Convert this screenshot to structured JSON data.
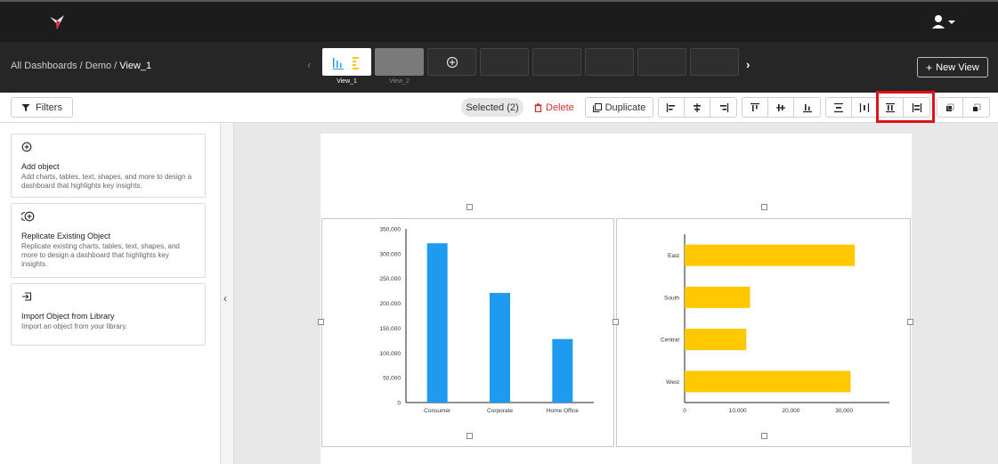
{
  "breadcrumb": {
    "root": "All Dashboards",
    "sep1": " / ",
    "mid": "Demo",
    "sep2": " / ",
    "current": "View_1"
  },
  "views": [
    {
      "label": "View_1"
    },
    {
      "label": "View_2"
    }
  ],
  "new_view_label": "New View",
  "toolbar": {
    "filters_label": "Filters",
    "selected_label": "Selected (2)",
    "delete_label": "Delete",
    "duplicate_label": "Duplicate"
  },
  "panel": {
    "items": [
      {
        "title": "Add object",
        "desc": "Add charts, tables, text, shapes, and more to design a dashboard that highlights key insights."
      },
      {
        "title": "Replicate Existing Object",
        "desc": "Replicate existing charts, tables, text, shapes, and more to design a dashboard that highlights key insights."
      },
      {
        "title": "Import Object from Library",
        "desc": "Import an object from your library."
      }
    ]
  },
  "colors": {
    "accent": "#f5c400",
    "bar_blue": "#1e9bf0",
    "bar_yellow": "#ffc800",
    "highlight": "#e0131b"
  },
  "chart_data": [
    {
      "type": "bar",
      "categories": [
        "Consumer",
        "Corporate",
        "Home Office"
      ],
      "values": [
        321000,
        221000,
        128000
      ],
      "yticks": [
        "0",
        "50,000",
        "100,000",
        "150,000",
        "200,000",
        "250,000",
        "300,000",
        "350,000"
      ],
      "ylim": [
        0,
        350000
      ],
      "color": "#1e9bf0"
    },
    {
      "type": "bar-horizontal",
      "categories": [
        "East",
        "South",
        "Central",
        "West"
      ],
      "values": [
        32000,
        12300,
        11600,
        31200
      ],
      "xticks": [
        "0",
        "10,000",
        "20,000",
        "30,000"
      ],
      "xlim": [
        0,
        38500
      ],
      "color": "#ffc800"
    }
  ]
}
